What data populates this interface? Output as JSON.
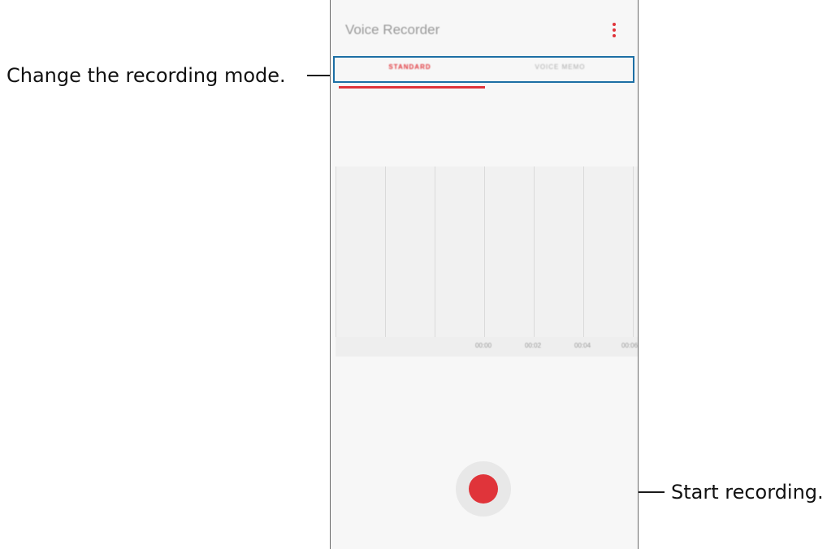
{
  "annotations": {
    "mode": "Change the recording mode.",
    "record": "Start recording."
  },
  "app": {
    "title": "Voice Recorder",
    "more_icon": "more-vertical-icon",
    "tabs": [
      {
        "label": "STANDARD",
        "active": true
      },
      {
        "label": "VOICE MEMO",
        "active": false
      }
    ],
    "timeline": [
      "00:00",
      "00:02",
      "00:04",
      "00:06"
    ],
    "record_icon": "record-icon"
  },
  "colors": {
    "accent": "#e0343a",
    "highlight": "#1d6fa5"
  }
}
